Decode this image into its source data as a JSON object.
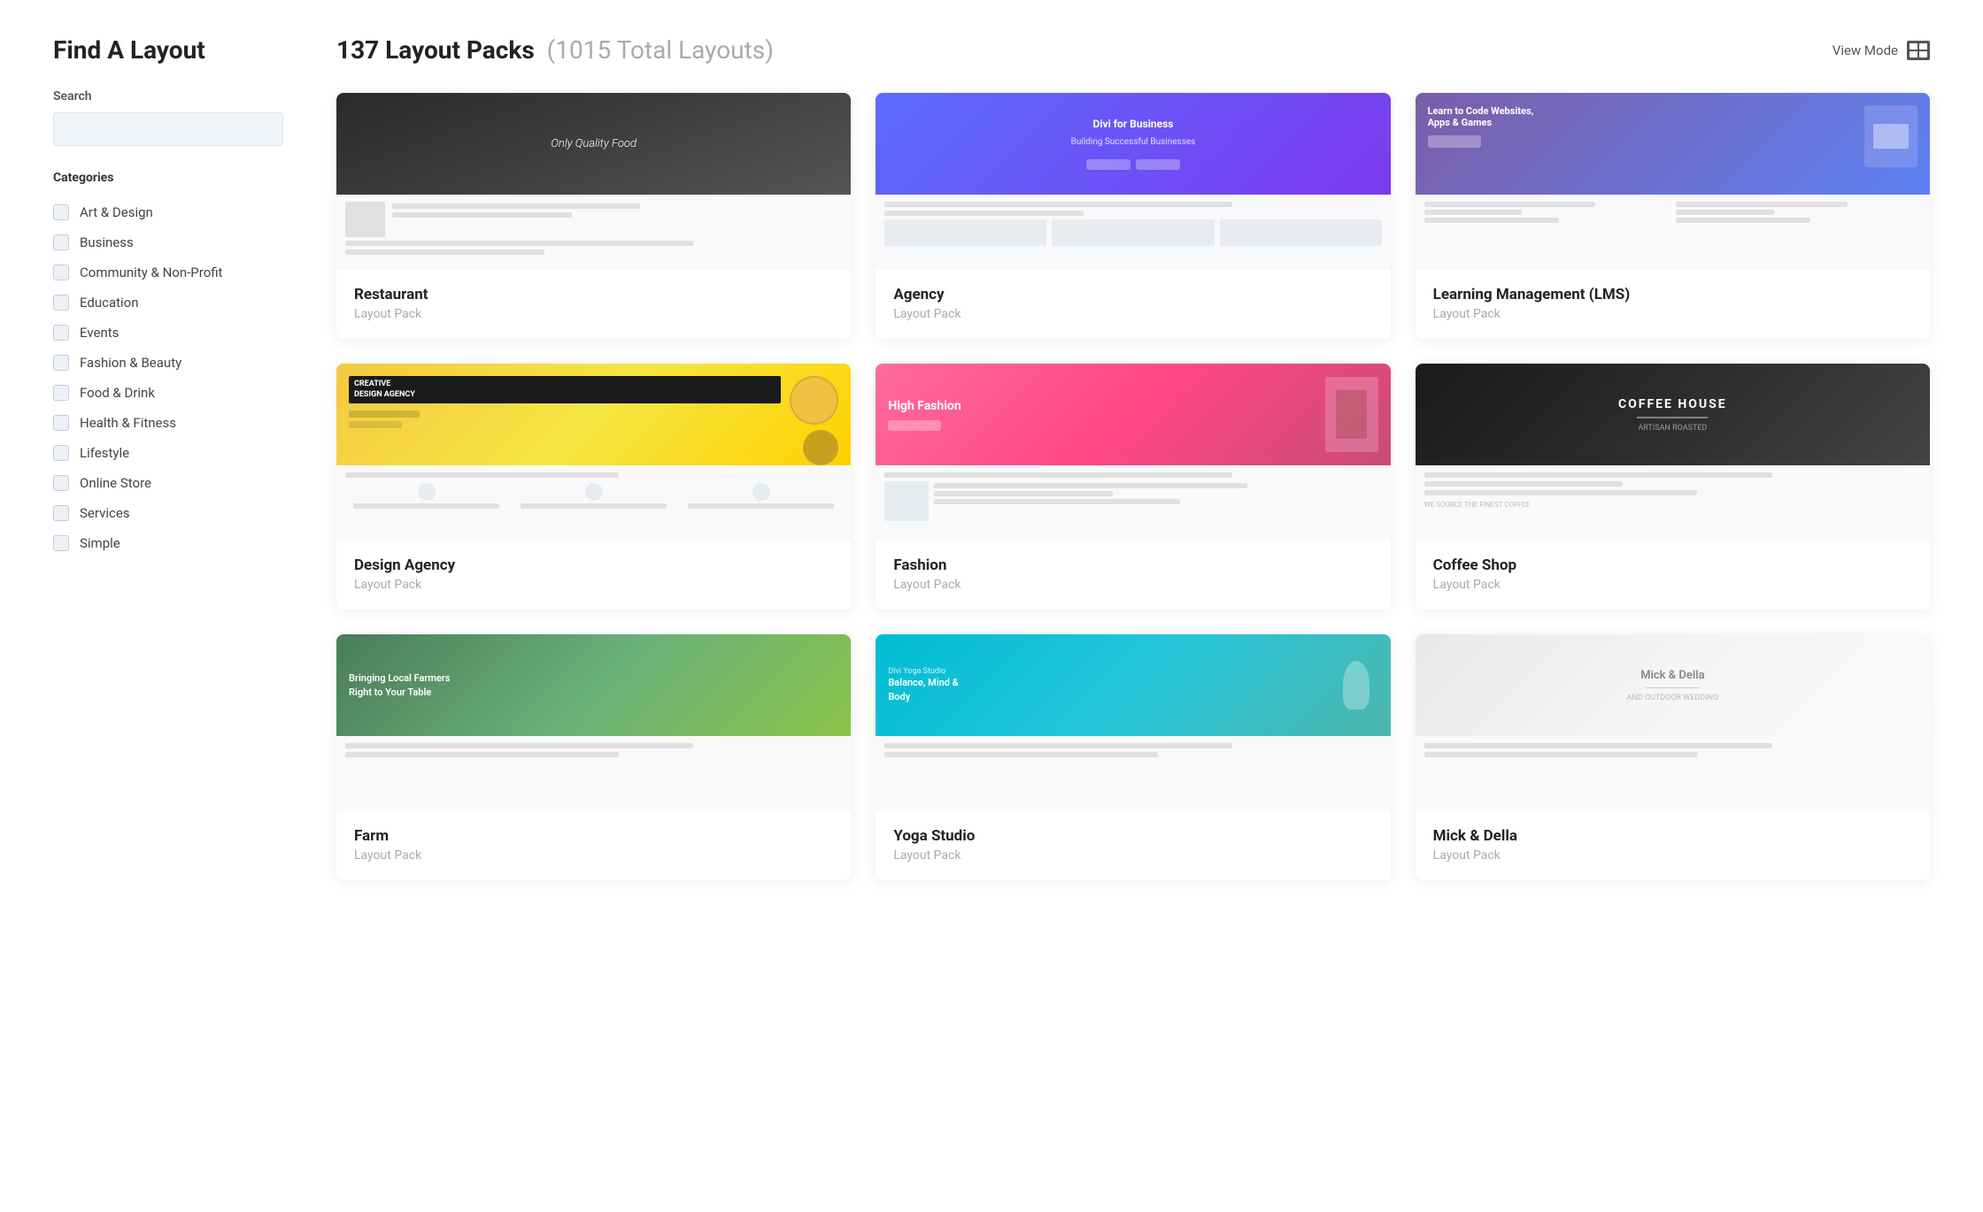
{
  "sidebar": {
    "title": "Find A Layout",
    "search": {
      "label": "Search",
      "placeholder": ""
    },
    "categories_label": "Categories",
    "categories": [
      {
        "id": "art-design",
        "label": "Art & Design"
      },
      {
        "id": "business",
        "label": "Business"
      },
      {
        "id": "community-non-profit",
        "label": "Community & Non-Profit"
      },
      {
        "id": "education",
        "label": "Education"
      },
      {
        "id": "events",
        "label": "Events"
      },
      {
        "id": "fashion-beauty",
        "label": "Fashion & Beauty"
      },
      {
        "id": "food-drink",
        "label": "Food & Drink"
      },
      {
        "id": "health-fitness",
        "label": "Health & Fitness"
      },
      {
        "id": "lifestyle",
        "label": "Lifestyle"
      },
      {
        "id": "online-store",
        "label": "Online Store"
      },
      {
        "id": "services",
        "label": "Services"
      },
      {
        "id": "simple",
        "label": "Simple"
      }
    ]
  },
  "main": {
    "packs_count": "137 Layout Packs",
    "packs_total": "(1015 Total Layouts)",
    "view_mode_label": "View Mode",
    "cards": [
      {
        "id": "restaurant",
        "name": "Restaurant",
        "type": "Layout Pack",
        "theme": "restaurant"
      },
      {
        "id": "agency",
        "name": "Agency",
        "type": "Layout Pack",
        "theme": "agency"
      },
      {
        "id": "lms",
        "name": "Learning Management (LMS)",
        "type": "Layout Pack",
        "theme": "lms"
      },
      {
        "id": "design-agency",
        "name": "Design Agency",
        "type": "Layout Pack",
        "theme": "design-agency"
      },
      {
        "id": "fashion",
        "name": "Fashion",
        "type": "Layout Pack",
        "theme": "fashion"
      },
      {
        "id": "coffee-shop",
        "name": "Coffee Shop",
        "type": "Layout Pack",
        "theme": "coffee"
      },
      {
        "id": "farm",
        "name": "Farm",
        "type": "Layout Pack",
        "theme": "farm"
      },
      {
        "id": "yoga",
        "name": "Yoga Studio",
        "type": "Layout Pack",
        "theme": "yoga"
      },
      {
        "id": "mick-della",
        "name": "Mick & Della",
        "type": "Layout Pack",
        "theme": "mick"
      }
    ]
  },
  "colors": {
    "accent": "#5b6bff",
    "text_primary": "#222",
    "text_secondary": "#aaa",
    "sidebar_bg": "#f0f4f8"
  }
}
